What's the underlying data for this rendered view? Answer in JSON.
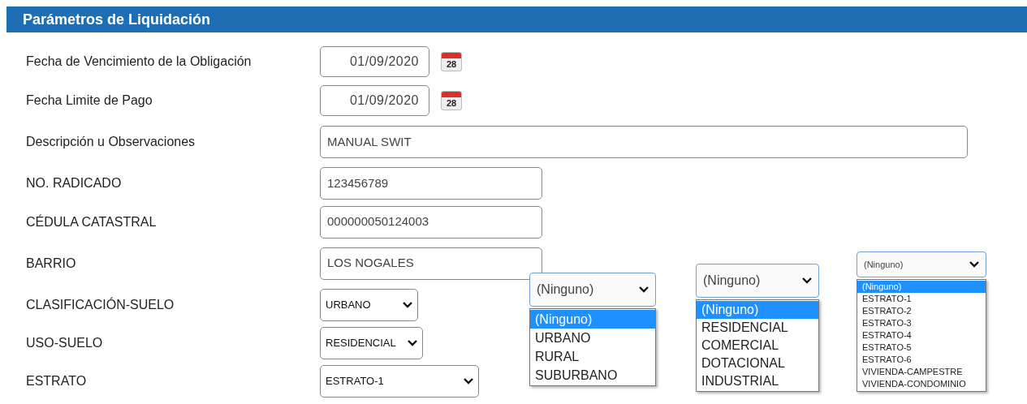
{
  "header": {
    "title": "Parámetros de Liquidación"
  },
  "fields": [
    {
      "kind": "date",
      "label": "Fecha de Vencimiento de la Obligación",
      "value": "01/09/2020",
      "calendar_day": "28"
    },
    {
      "kind": "date",
      "label": "Fecha Limite de Pago",
      "value": "01/09/2020",
      "calendar_day": "28"
    },
    {
      "kind": "long_text",
      "label": "Descripción u Observaciones",
      "value": "MANUAL SWIT"
    },
    {
      "kind": "text",
      "label": "NO. RADICADO",
      "value": "123456789"
    },
    {
      "kind": "text",
      "label": "CÉDULA CATASTRAL",
      "value": "000000050124003"
    },
    {
      "kind": "text",
      "label": "BARRIO",
      "value": "LOS NOGALES"
    },
    {
      "kind": "select",
      "label": "CLASIFICACIÓN-SUELO",
      "value": "URBANO"
    },
    {
      "kind": "select",
      "label": "USO-SUELO",
      "value": "RESIDENCIAL"
    },
    {
      "kind": "select",
      "label": "ESTRATO",
      "value": "ESTRATO-1"
    }
  ],
  "dropdowns": [
    {
      "value": "(Ninguno)",
      "options": [
        {
          "label": "(Ninguno)",
          "selected": true
        },
        {
          "label": "URBANO",
          "selected": false
        },
        {
          "label": "RURAL",
          "selected": false
        },
        {
          "label": "SUBURBANO",
          "selected": false
        }
      ]
    },
    {
      "value": "(Ninguno)",
      "options": [
        {
          "label": "(Ninguno)",
          "selected": true
        },
        {
          "label": "RESIDENCIAL",
          "selected": false
        },
        {
          "label": "COMERCIAL",
          "selected": false
        },
        {
          "label": "DOTACIONAL",
          "selected": false
        },
        {
          "label": "INDUSTRIAL",
          "selected": false
        }
      ]
    },
    {
      "value": "(Ninguno)",
      "options": [
        {
          "label": "(Ninguno)",
          "selected": true
        },
        {
          "label": "ESTRATO-1",
          "selected": false
        },
        {
          "label": "ESTRATO-2",
          "selected": false
        },
        {
          "label": "ESTRATO-3",
          "selected": false
        },
        {
          "label": "ESTRATO-4",
          "selected": false
        },
        {
          "label": "ESTRATO-5",
          "selected": false
        },
        {
          "label": "ESTRATO-6",
          "selected": false
        },
        {
          "label": "VIVIENDA-CAMPESTRE",
          "selected": false
        },
        {
          "label": "VIVIENDA-CONDOMINIO",
          "selected": false
        }
      ]
    }
  ]
}
